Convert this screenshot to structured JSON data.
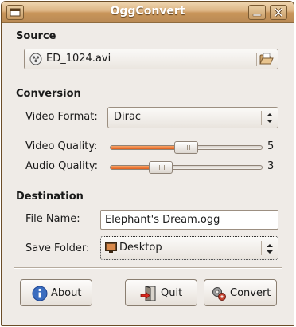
{
  "window": {
    "title": "OggConvert"
  },
  "source": {
    "heading": "Source",
    "file": "ED_1024.avi",
    "left_icon": "video-file-icon",
    "right_icon": "open-folder-icon"
  },
  "conversion": {
    "heading": "Conversion",
    "video_format_label": "Video Format:",
    "video_format_value": "Dirac",
    "video_quality_label": "Video Quality:",
    "video_quality_value": "5",
    "video_quality_fraction": 0.5,
    "audio_quality_label": "Audio Quality:",
    "audio_quality_value": "3",
    "audio_quality_fraction": 0.3
  },
  "destination": {
    "heading": "Destination",
    "file_name_label": "File Name:",
    "file_name_value": "Elephant's Dream.ogg",
    "save_folder_label": "Save Folder:",
    "save_folder_value": "Desktop"
  },
  "buttons": {
    "about": {
      "mnemonic": "A",
      "rest": "bout"
    },
    "quit": {
      "mnemonic": "Q",
      "rest": "uit"
    },
    "convert": {
      "mnemonic": "C",
      "rest": "onvert"
    }
  },
  "colors": {
    "accent": "#e2611c",
    "titlebar": "#c8955a"
  }
}
